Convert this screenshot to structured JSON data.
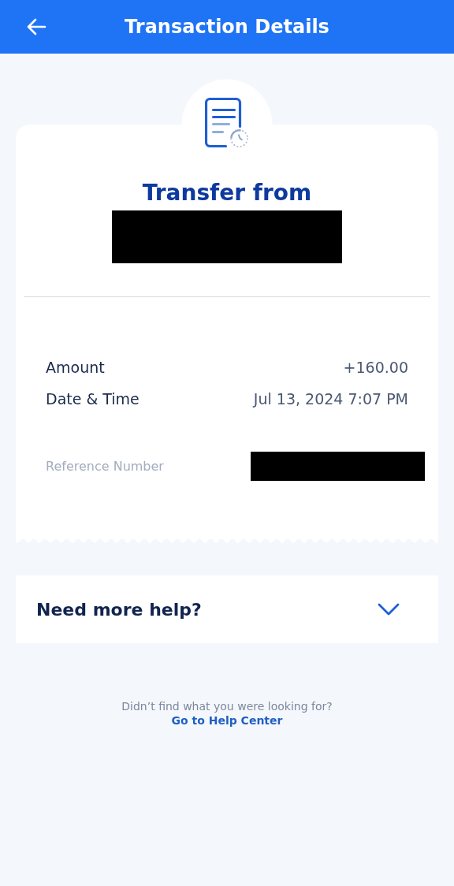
{
  "header": {
    "title": "Transaction Details"
  },
  "receipt": {
    "heading": "Transfer from",
    "sender_redacted": true,
    "details": [
      {
        "label": "Amount",
        "value": "+160.00"
      },
      {
        "label": "Date & Time",
        "value": "Jul 13, 2024 7:07 PM"
      }
    ],
    "reference": {
      "label": "Reference Number",
      "redacted": true
    }
  },
  "help": {
    "title": "Need more help?",
    "expanded": false
  },
  "footer": {
    "text": "Didn’t find what you were looking for?",
    "link": "Go to Help Center"
  }
}
